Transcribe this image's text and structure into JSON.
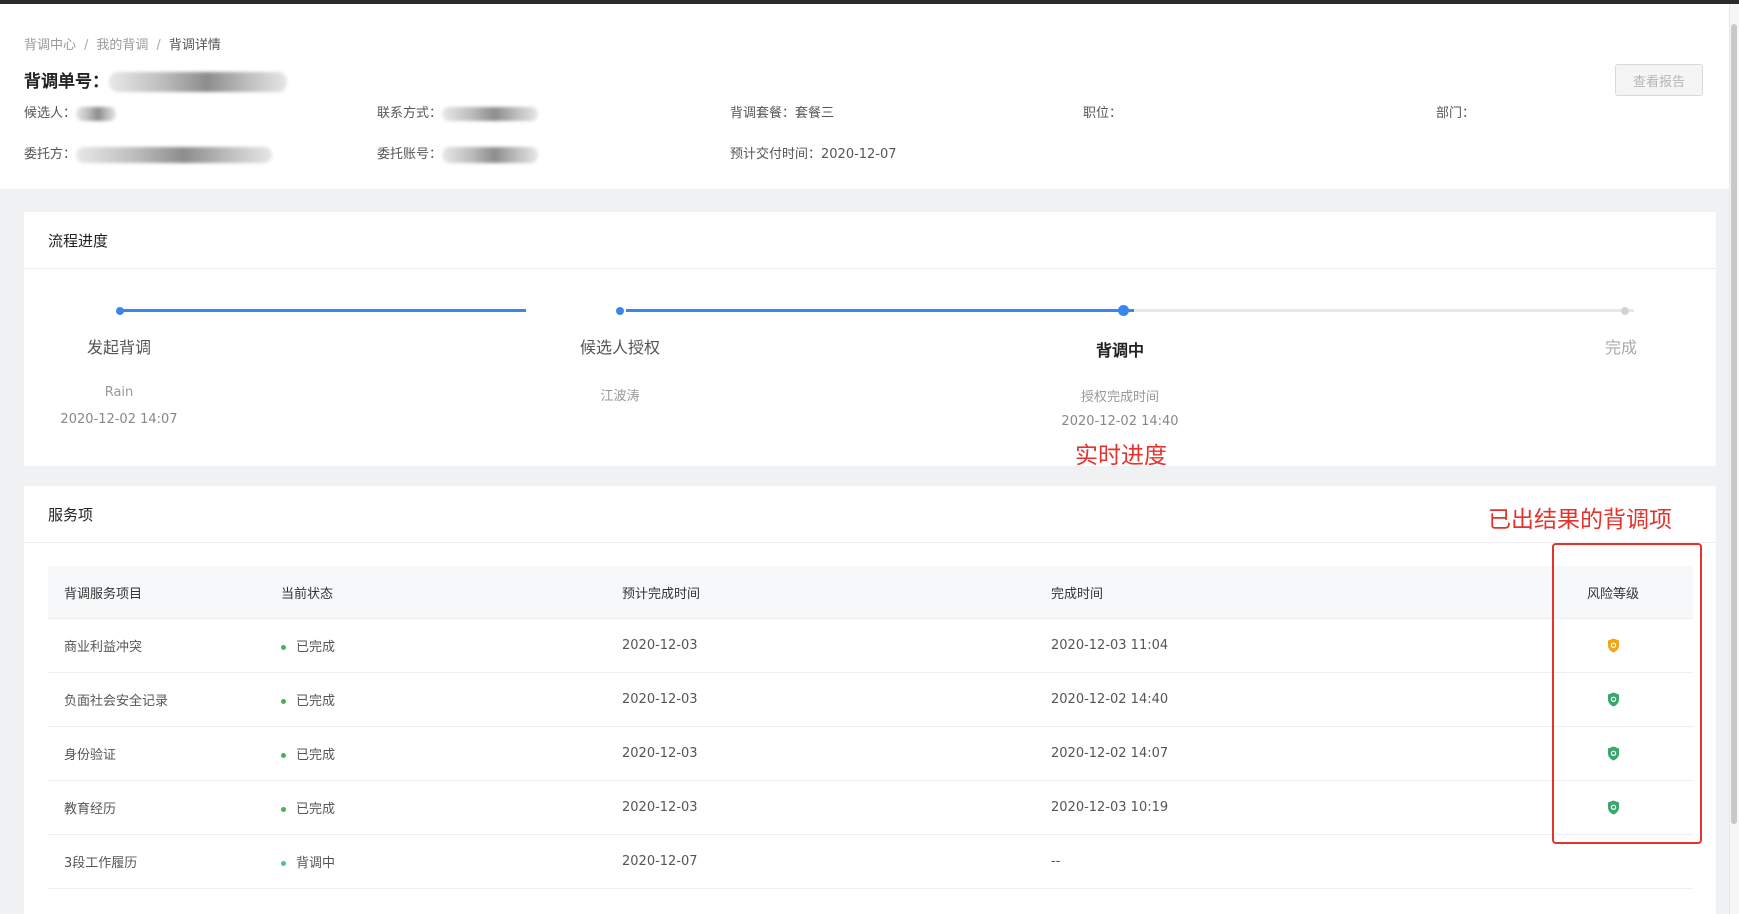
{
  "breadcrumb": [
    "背调中心",
    "我的背调",
    "背调详情"
  ],
  "order": {
    "label": "背调单号："
  },
  "view_report_label": "查看报告",
  "info": {
    "candidate_label": "候选人：",
    "contact_label": "联系方式：",
    "package_label": "背调套餐：",
    "package_value": "套餐三",
    "position_label": "职位：",
    "department_label": "部门：",
    "client_label": "委托方：",
    "account_label": "委托账号：",
    "delivery_label": "预计交付时间：",
    "delivery_value": "2020-12-07"
  },
  "progress": {
    "title": "流程进度",
    "steps": [
      {
        "title": "发起背调",
        "sub": "Rain",
        "time": "2020-12-02 14:07",
        "state": "done"
      },
      {
        "title": "候选人授权",
        "sub": "江波涛",
        "time": "",
        "state": "done"
      },
      {
        "title": "背调中",
        "sub": "授权完成时间",
        "time": "2020-12-02 14:40",
        "state": "active"
      },
      {
        "title": "完成",
        "sub": "",
        "time": "",
        "state": "pending"
      }
    ],
    "annotation": "实时进度"
  },
  "services": {
    "title": "服务项",
    "annotation": "已出结果的背调项",
    "columns": [
      "背调服务项目",
      "当前状态",
      "预计完成时间",
      "完成时间",
      "风险等级"
    ],
    "rows": [
      {
        "item": "商业利益冲突",
        "status": "已完成",
        "expected": "2020-12-03",
        "completed": "2020-12-03 11:04",
        "risk": "medium"
      },
      {
        "item": "负面社会安全记录",
        "status": "已完成",
        "expected": "2020-12-03",
        "completed": "2020-12-02 14:40",
        "risk": "low"
      },
      {
        "item": "身份验证",
        "status": "已完成",
        "expected": "2020-12-03",
        "completed": "2020-12-02 14:07",
        "risk": "low"
      },
      {
        "item": "教育经历",
        "status": "已完成",
        "expected": "2020-12-03",
        "completed": "2020-12-03 10:19",
        "risk": "low"
      },
      {
        "item": "3段工作履历",
        "status": "背调中",
        "expected": "2020-12-07",
        "completed": "--",
        "risk": ""
      }
    ]
  },
  "colors": {
    "accent": "#3b86ee",
    "done_status": "#4caf50",
    "in_progress_status": "#45c1b2",
    "risk_medium": "#f2a51b",
    "risk_low": "#3aa76d",
    "annotation": "#e5322d"
  }
}
